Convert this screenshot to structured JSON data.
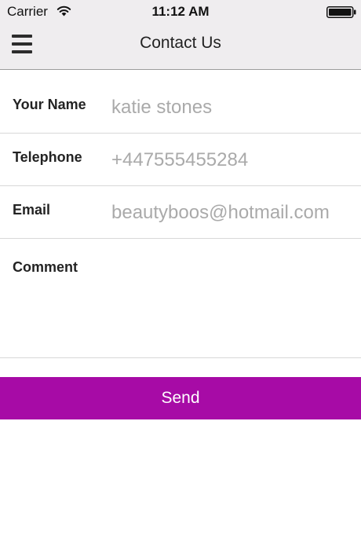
{
  "status_bar": {
    "carrier": "Carrier",
    "time": "11:12 AM",
    "wifi_icon": "wifi-icon",
    "battery_icon": "battery-icon"
  },
  "nav": {
    "title": "Contact Us",
    "menu_icon": "hamburger-menu-icon"
  },
  "form": {
    "name": {
      "label": "Your Name",
      "value": "katie stones"
    },
    "phone": {
      "label": "Telephone",
      "value": "+447555455284"
    },
    "email": {
      "label": "Email",
      "value": "beautyboos@hotmail.com"
    },
    "comment": {
      "label": "Comment",
      "value": ""
    }
  },
  "send_button": {
    "label": "Send"
  },
  "colors": {
    "bar_background": "#efedef",
    "accent": "#a70ba6",
    "input_text": "#aaaaaa"
  }
}
